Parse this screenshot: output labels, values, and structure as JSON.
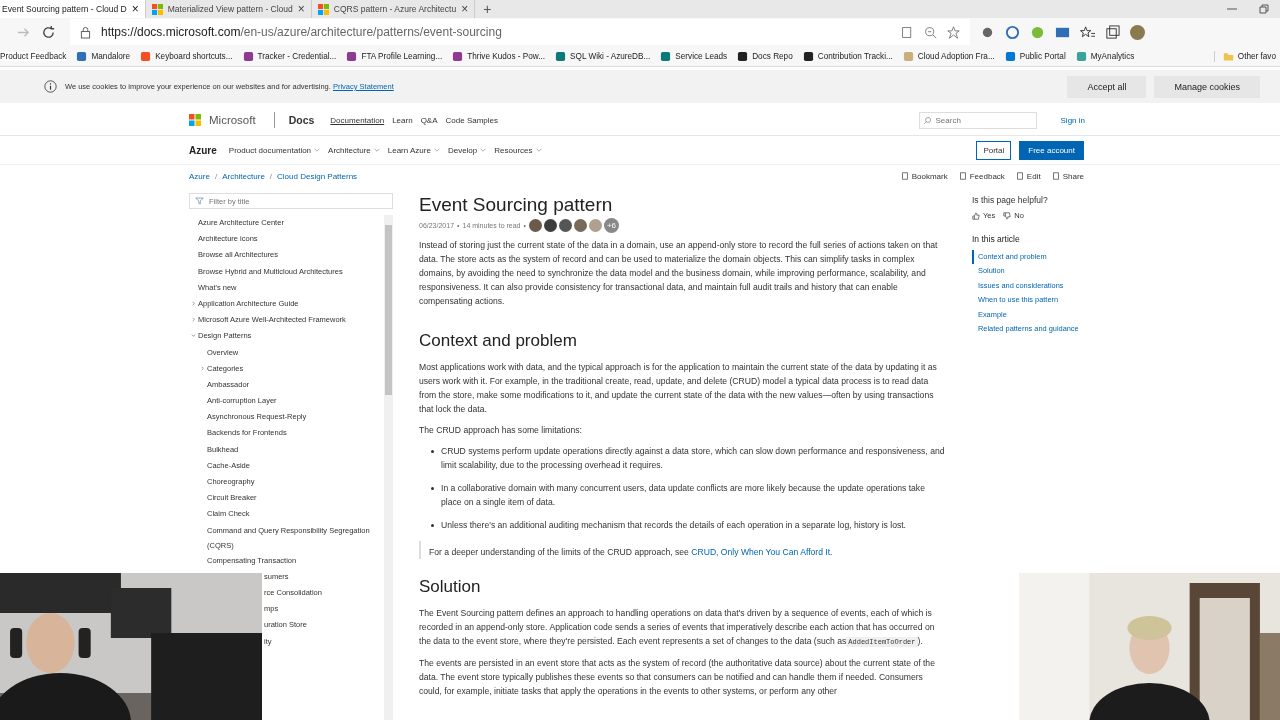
{
  "browser": {
    "tabs": [
      {
        "title": "Event Sourcing pattern - Cloud D",
        "close": "×",
        "selected": true
      },
      {
        "title": "Materialized View pattern - Cloud",
        "close": "×",
        "selected": false
      },
      {
        "title": "CQRS pattern - Azure Architectu",
        "close": "×",
        "selected": false
      }
    ],
    "new_tab": "+",
    "url_host": "https://docs.microsoft.com",
    "url_path": "/en-us/azure/architecture/patterns/event-sourcing",
    "bookmarks": [
      {
        "label": "Product Feedback",
        "color": "#ffffff"
      },
      {
        "label": "Mandalore",
        "color": "#2f6fb5"
      },
      {
        "label": "Keyboard shortcuts...",
        "color": "#f25022"
      },
      {
        "label": "Tracker - Credential...",
        "color": "#8e3a8e"
      },
      {
        "label": "FTA Profile Learning...",
        "color": "#8e3a8e"
      },
      {
        "label": "Thrive Kudos - Pow...",
        "color": "#8e3a8e"
      },
      {
        "label": "SQL Wiki - AzureDB...",
        "color": "#0d7a7a"
      },
      {
        "label": "Service Leads",
        "color": "#0d7a7a"
      },
      {
        "label": "Docs Repo",
        "color": "#222222"
      },
      {
        "label": "Contribution Tracki...",
        "color": "#222222"
      },
      {
        "label": "Cloud Adoption Fra...",
        "color": "#c9b07a"
      },
      {
        "label": "Public Portal",
        "color": "#0078d4"
      },
      {
        "label": "MyAnalytics",
        "color": "#3aa39a"
      }
    ],
    "other_favorites": "Other favo"
  },
  "cookie_bar": {
    "text": "We use cookies to improve your experience on our websites and for advertising.",
    "link": "Privacy Statement",
    "buttons": [
      "Accept all",
      "Manage cookies"
    ]
  },
  "header": {
    "brand": "Microsoft",
    "site": "Docs",
    "links": [
      {
        "label": "Documentation",
        "selected": true
      },
      {
        "label": "Learn",
        "selected": false
      },
      {
        "label": "Q&A",
        "selected": false
      },
      {
        "label": "Code Samples",
        "selected": false
      }
    ],
    "search_placeholder": "Search",
    "sign_in": "Sign in"
  },
  "subnav": {
    "title": "Azure",
    "menus": [
      "Product documentation",
      "Architecture",
      "Learn Azure",
      "Develop",
      "Resources"
    ],
    "portal": "Portal",
    "free_account": "Free account"
  },
  "breadcrumb": [
    "Azure",
    "Architecture",
    "Cloud Design Patterns"
  ],
  "breadcrumb_separator": "/",
  "actions": [
    "Bookmark",
    "Feedback",
    "Edit",
    "Share"
  ],
  "nav": {
    "filter_placeholder": "Filter by title",
    "items": [
      {
        "label": "Azure Architecture Center",
        "kind": "leaf"
      },
      {
        "label": "Architecture icons",
        "kind": "leaf"
      },
      {
        "label": "Browse all Architectures",
        "kind": "leaf"
      },
      {
        "label": "Browse Hybrid and Multicloud Architectures",
        "kind": "leaf"
      },
      {
        "label": "What's new",
        "kind": "leaf"
      },
      {
        "label": "Application Architecture Guide",
        "kind": "group",
        "expanded": false
      },
      {
        "label": "Microsoft Azure Well-Architected Framework",
        "kind": "group",
        "expanded": false
      },
      {
        "label": "Design Patterns",
        "kind": "group",
        "expanded": true,
        "children": [
          {
            "label": "Overview",
            "kind": "leaf"
          },
          {
            "label": "Categories",
            "kind": "group",
            "expanded": false
          },
          {
            "label": "Ambassador",
            "kind": "leaf"
          },
          {
            "label": "Anti-corruption Layer",
            "kind": "leaf"
          },
          {
            "label": "Asynchronous Request-Reply",
            "kind": "leaf"
          },
          {
            "label": "Backends for Frontends",
            "kind": "leaf"
          },
          {
            "label": "Bulkhead",
            "kind": "leaf"
          },
          {
            "label": "Cache-Aside",
            "kind": "leaf"
          },
          {
            "label": "Choreography",
            "kind": "leaf"
          },
          {
            "label": "Circuit Breaker",
            "kind": "leaf"
          },
          {
            "label": "Claim Check",
            "kind": "leaf"
          },
          {
            "label": "Command and Query Responsibility Segregation (CQRS)",
            "kind": "leaf"
          },
          {
            "label": "Compensating Transaction",
            "kind": "leaf"
          },
          {
            "label": "sumers",
            "kind": "partial"
          },
          {
            "label": "rce Consolidation",
            "kind": "partial"
          },
          {
            "label": "mps",
            "kind": "partial"
          },
          {
            "label": "uration Store",
            "kind": "partial"
          },
          {
            "label": "ity",
            "kind": "partial"
          }
        ]
      }
    ]
  },
  "article": {
    "title": "Event Sourcing pattern",
    "date": "06/23/2017",
    "read_time": "14 minutes to read",
    "separator": "•",
    "contributors": [
      {
        "color": "#6b5a4a"
      },
      {
        "color": "#3d3d3d"
      },
      {
        "color": "#555555"
      },
      {
        "color": "#7a6a5a"
      },
      {
        "color": "#b0a090"
      }
    ],
    "more_contributors": "+6",
    "intro": "Instead of storing just the current state of the data in a domain, use an append-only store to record the full series of actions taken on that data. The store acts as the system of record and can be used to materialize the domain objects. This can simplify tasks in complex domains, by avoiding the need to synchronize the data model and the business domain, while improving performance, scalability, and responsiveness. It can also provide consistency for transactional data, and maintain full audit trails and history that can enable compensating actions.",
    "sections": [
      {
        "heading": "Context and problem",
        "blocks": [
          {
            "kind": "p",
            "text": "Most applications work with data, and the typical approach is for the application to maintain the current state of the data by updating it as users work with it. For example, in the traditional create, read, update, and delete (CRUD) model a typical data process is to read data from the store, make some modifications to it, and update the current state of the data with the new values—often by using transactions that lock the data."
          },
          {
            "kind": "p",
            "text": "The CRUD approach has some limitations:"
          },
          {
            "kind": "ul",
            "items": [
              "CRUD systems perform update operations directly against a data store, which can slow down performance and responsiveness, and limit scalability, due to the processing overhead it requires.",
              "In a collaborative domain with many concurrent users, data update conflicts are more likely because the update operations take place on a single item of data.",
              "Unless there's an additional auditing mechanism that records the details of each operation in a separate log, history is lost."
            ]
          },
          {
            "kind": "note",
            "text": "For a deeper understanding of the limits of the CRUD approach, see",
            "link": "CRUD, Only When You Can Afford It",
            "end": "."
          }
        ]
      },
      {
        "heading": "Solution",
        "blocks": [
          {
            "kind": "p",
            "text": "The Event Sourcing pattern defines an approach to handling operations on data that's driven by a sequence of events, each of which is recorded in an append-only store. Application code sends a series of events that imperatively describe each action that has occurred on the data to the event store, where they're persisted. Each event represents a set of changes to the data (such as",
            "code": "AddedItemToOrder",
            "end": ")."
          },
          {
            "kind": "p",
            "text": "The events are persisted in an event store that acts as the system of record (the authoritative data source) about the current state of the data. The event store typically publishes these events so that consumers can be notified and can handle them if needed. Consumers could, for example, initiate tasks that apply the operations in the events to other systems, or perform any other"
          }
        ]
      }
    ]
  },
  "aside": {
    "helpful": "Is this page helpful?",
    "yes": "Yes",
    "no": "No",
    "toc_title": "In this article",
    "toc": [
      {
        "label": "Context and problem",
        "selected": true
      },
      {
        "label": "Solution",
        "selected": false
      },
      {
        "label": "Issues and considerations",
        "selected": false
      },
      {
        "label": "When to use this pattern",
        "selected": false
      },
      {
        "label": "Example",
        "selected": false
      },
      {
        "label": "Related patterns and guidance",
        "selected": false
      }
    ]
  },
  "webcams": [
    {
      "kind": "picture"
    },
    {
      "kind": "picture"
    }
  ]
}
